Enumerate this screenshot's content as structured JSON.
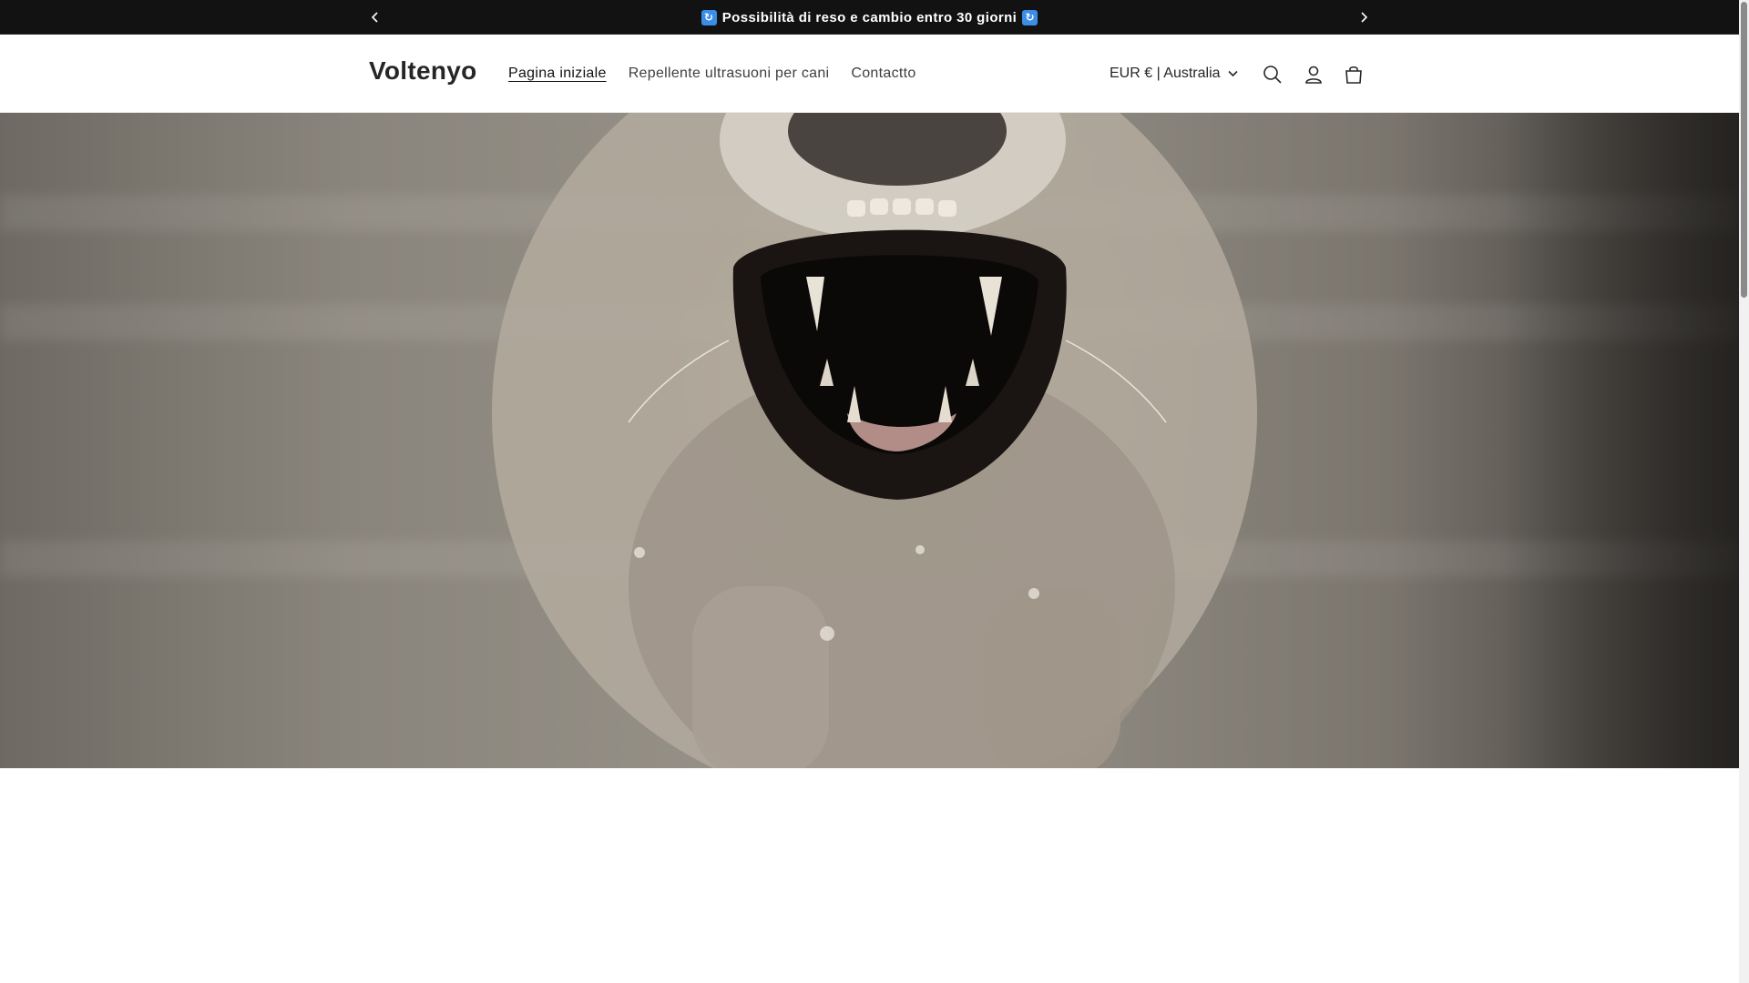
{
  "announcement": {
    "text": "Possibilità di reso e cambio entro 30 giorni",
    "emoji_icon": "refresh-emoji-icon"
  },
  "header": {
    "logo": "Voltenyo",
    "nav": [
      {
        "label": "Pagina iniziale",
        "active": true
      },
      {
        "label": "Repellente ultrasuoni per cani",
        "active": false
      },
      {
        "label": "Contactto",
        "active": false
      }
    ],
    "locale": "EUR € | Australia",
    "icons": [
      "search-icon",
      "account-icon",
      "cart-icon"
    ]
  },
  "hero": {
    "image": "barking-dog-hero-image"
  },
  "colors": {
    "announcement_bg": "#121212",
    "text": "#121212",
    "background": "#ffffff"
  }
}
